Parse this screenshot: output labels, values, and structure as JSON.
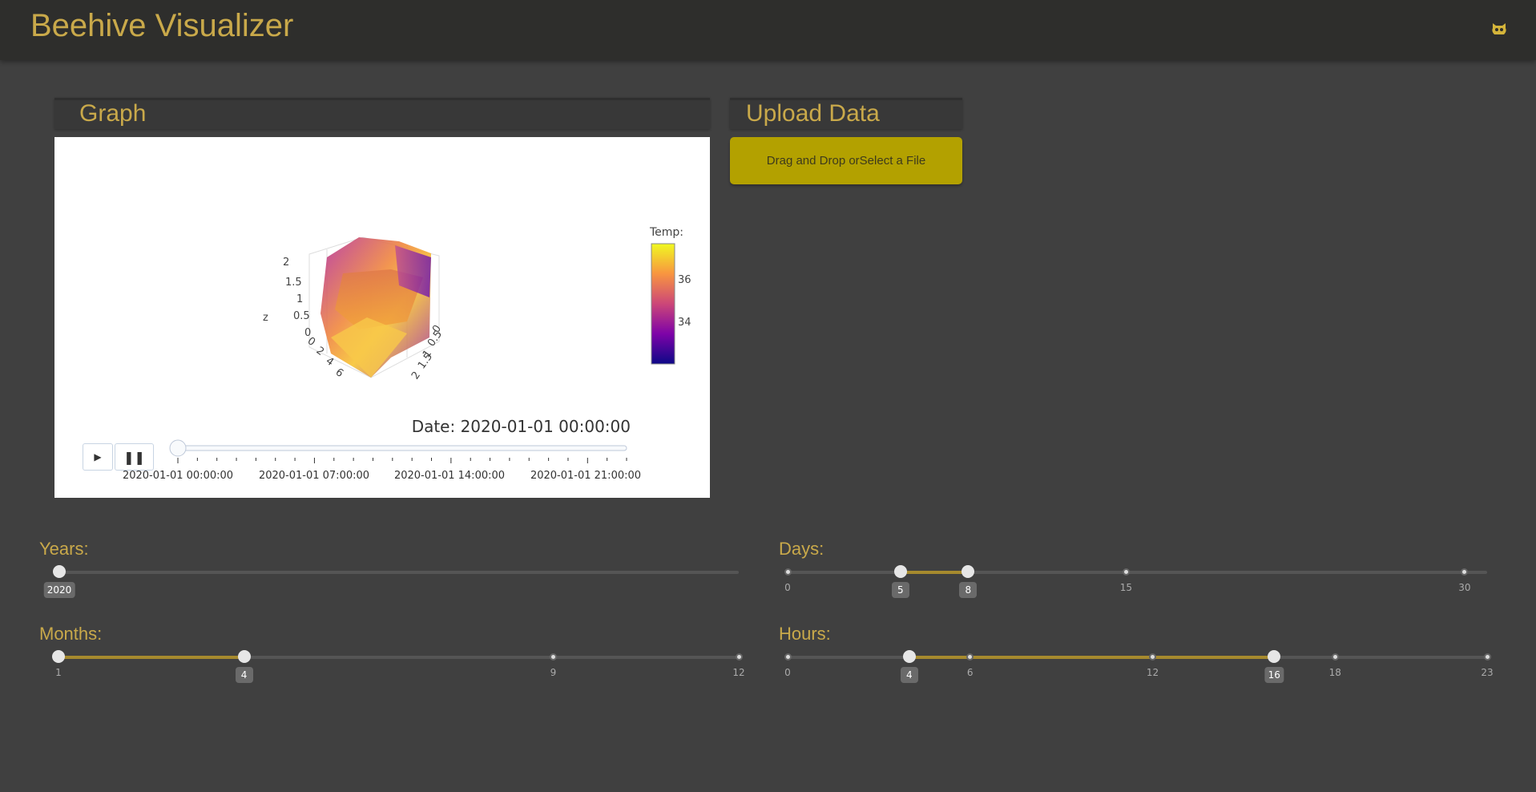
{
  "header": {
    "title": "Beehive Visualizer",
    "github_icon": "github-octocat-icon"
  },
  "graph": {
    "title": "Graph",
    "date_label": "Date: 2020-01-01 00:00:00",
    "colorbar": {
      "title": "Temp:",
      "ticks": [
        "36",
        "34"
      ],
      "range": [
        32.6,
        37.7
      ],
      "colorscale": "plasma"
    },
    "axes": {
      "z_title": "z",
      "z_ticks": [
        "2",
        "1.5",
        "1",
        "0.5",
        "0"
      ],
      "x_ticks": [
        "0",
        "2",
        "4",
        "6"
      ],
      "y_ticks": [
        "0",
        "0.5",
        "1",
        "1.5",
        "2"
      ]
    },
    "animation": {
      "play_icon": "play-icon",
      "pause_icon": "pause-icon",
      "value_fraction": 0,
      "tick_labels": [
        "2020-01-01 00:00:00",
        "2020-01-01 07:00:00",
        "2020-01-01 14:00:00",
        "2020-01-01 21:00:00"
      ]
    }
  },
  "upload": {
    "title": "Upload Data",
    "button_label": "Drag and Drop orSelect a File"
  },
  "filters": {
    "years": {
      "label": "Years:",
      "value": "2020"
    },
    "days": {
      "label": "Days:",
      "marks": [
        "0",
        "15",
        "30"
      ],
      "range": [
        "5",
        "8"
      ]
    },
    "months": {
      "label": "Months:",
      "marks": [
        "1",
        "9",
        "12"
      ],
      "range": [
        "1",
        "4"
      ],
      "value": "4"
    },
    "hours": {
      "label": "Hours:",
      "marks": [
        "0",
        "6",
        "12",
        "18",
        "23"
      ],
      "range": [
        "4",
        "16"
      ]
    }
  },
  "colors": {
    "accent": "#c9a94a",
    "upload": "#b3a100",
    "range_fill": "#a68a2e"
  }
}
